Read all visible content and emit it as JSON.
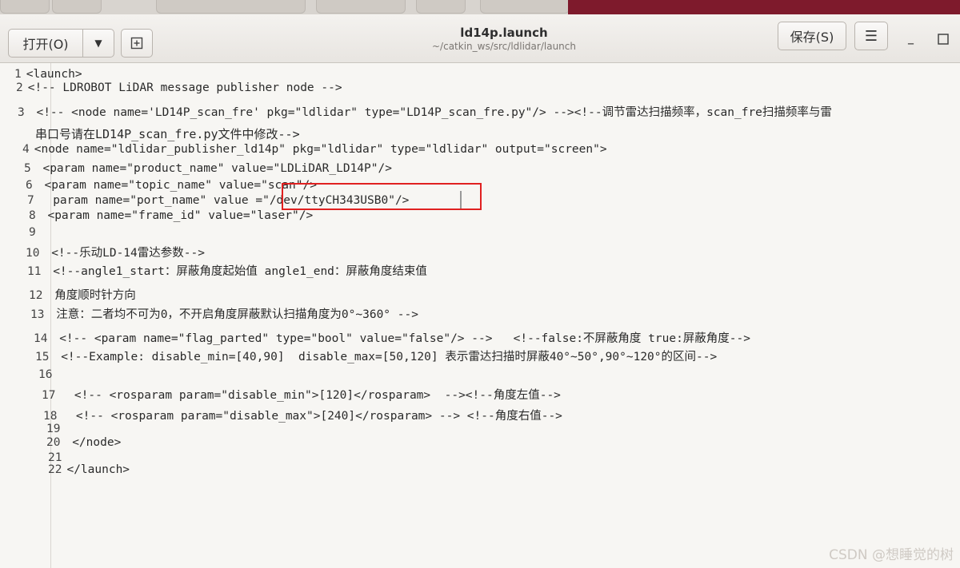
{
  "window": {
    "title": "ld14p.launch",
    "path": "~/catkin_ws/src/ldlidar/launch"
  },
  "toolbar": {
    "open_label": "打开(O)",
    "save_label": "保存(S)"
  },
  "code_lines": [
    {
      "n": "1",
      "text": "<launch>"
    },
    {
      "n": "2",
      "text": "<!-- LDROBOT LiDAR message publisher node -->"
    },
    {
      "n": "3",
      "text": " <!-- <node name='LD14P_scan_fre' pkg=\"ldlidar\" type=\"LD14P_scan_fre.py\"/> --><!--调节雷达扫描频率，scan_fre扫描频率与雷"
    },
    {
      "n": "",
      "text": "串口号请在LD14P_scan_fre.py文件中修改-->"
    },
    {
      "n": "4",
      "text": "<node name=\"ldlidar_publisher_ld14p\" pkg=\"ldlidar\" type=\"ldlidar\" output=\"screen\">"
    },
    {
      "n": "5",
      "text": " <param name=\"product_name\" value=\"LDLiDAR_LD14P\"/>"
    },
    {
      "n": "6",
      "text": " <param name=\"topic_name\" value=\"scan\"/>"
    },
    {
      "n": "7",
      "text": "  param name=\"port_name\" value =\"/dev/ttyCH343USB0\"/>"
    },
    {
      "n": "8",
      "text": " <param name=\"frame_id\" value=\"laser\"/>"
    },
    {
      "n": "9",
      "text": ""
    },
    {
      "n": "10",
      "text": " <!--乐动LD-14雷达参数-->"
    },
    {
      "n": "11",
      "text": " <!--angle1_start：屏蔽角度起始值 angle1_end：屏蔽角度结束值"
    },
    {
      "n": "12",
      "text": " 角度顺时针方向"
    },
    {
      "n": "13",
      "text": " 注意：二者均不可为0，不开启角度屏蔽默认扫描角度为0°~360° -->"
    },
    {
      "n": "14",
      "text": " <!-- <param name=\"flag_parted\" type=\"bool\" value=\"false\"/> -->   <!--false:不屏蔽角度 true:屏蔽角度-->"
    },
    {
      "n": "15",
      "text": " <!--Example: disable_min=[40,90]  disable_max=[50,120] 表示雷达扫描时屏蔽40°~50°,90°~120°的区间-->"
    },
    {
      "n": "16",
      "text": ""
    },
    {
      "n": "17",
      "text": "  <!-- <rosparam param=\"disable_min\">[120]</rosparam>  --><!--角度左值-->"
    },
    {
      "n": "18",
      "text": "  <!-- <rosparam param=\"disable_max\">[240]</rosparam> --> <!--角度右值-->"
    },
    {
      "n": "19",
      "text": ""
    },
    {
      "n": "20",
      "text": " </node>"
    },
    {
      "n": "21",
      "text": ""
    },
    {
      "n": "22",
      "text": "</launch>"
    }
  ],
  "watermark": "CSDN @想睡觉的树"
}
